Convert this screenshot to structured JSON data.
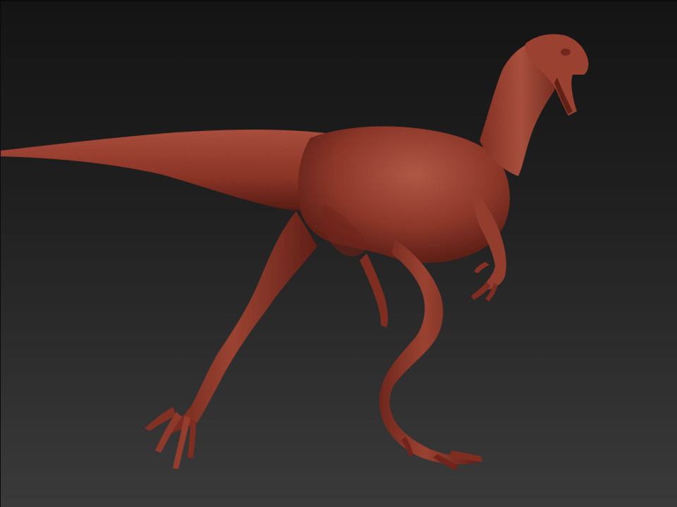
{
  "scene": {
    "subject_icon": "dinosaur-sculpt",
    "background_top_color": "#141414",
    "background_bottom_color": "#3a3a3a",
    "model_base_color": "#9a3e30",
    "model_shadow_color": "#5c2018",
    "model_highlight_color": "#c0614e"
  }
}
